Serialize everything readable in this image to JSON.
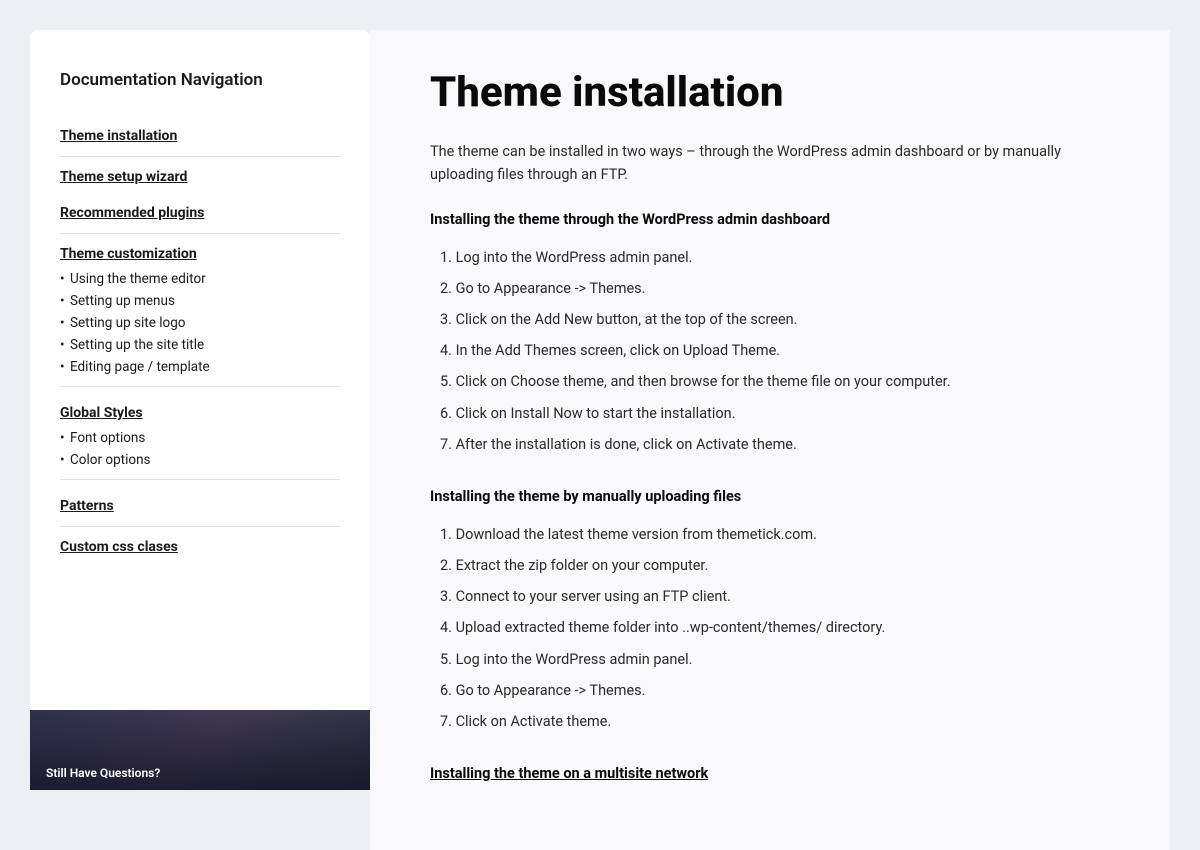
{
  "sidebar": {
    "title": "Documentation Navigation",
    "nav_items": [
      {
        "id": "theme-installation",
        "label": "Theme installation",
        "type": "link"
      },
      {
        "id": "theme-setup-wizard",
        "label": "Theme setup wizard",
        "type": "link"
      },
      {
        "id": "recommended-plugins",
        "label": "Recommended plugins",
        "type": "link"
      },
      {
        "id": "theme-customization",
        "label": "Theme customization",
        "type": "section",
        "children": [
          "Using the theme editor",
          "Setting up menus",
          "Setting up site logo",
          "Setting up the site title",
          "Editing page / template"
        ]
      },
      {
        "id": "global-styles",
        "label": "Global Styles",
        "type": "section",
        "children": [
          "Font options",
          "Color options"
        ]
      },
      {
        "id": "patterns",
        "label": "Patterns",
        "type": "link"
      },
      {
        "id": "custom-css-classes",
        "label": "Custom css clases",
        "type": "link"
      }
    ],
    "thumbnail_text": "Still Have Questions?"
  },
  "main": {
    "page_title": "Theme installation",
    "intro": "The theme can be installed in two ways – through the WordPress admin dashboard or by manually uploading files through an FTP.",
    "sections": [
      {
        "id": "admin-dashboard",
        "heading": "Installing the theme through the WordPress admin dashboard",
        "heading_type": "bold",
        "items": [
          "Log into the WordPress admin panel.",
          "Go to Appearance -> Themes.",
          "Click on the Add New button, at the top of the screen.",
          "In the Add Themes screen, click on Upload Theme.",
          "Click on Choose theme, and then browse for the theme file on your computer.",
          "Click on Install Now to start the installation.",
          "After the installation is done, click on Activate theme."
        ]
      },
      {
        "id": "ftp-upload",
        "heading": "Installing the theme by manually uploading files",
        "heading_type": "bold",
        "items": [
          "Download the latest theme version from themetick.com.",
          "Extract the zip folder on your computer.",
          "Connect to your server using an FTP client.",
          "Upload extracted theme folder into ..wp-content/themes/ directory.",
          "Log into the WordPress admin panel.",
          "Go to Appearance -> Themes.",
          "Click on Activate theme."
        ]
      },
      {
        "id": "multisite",
        "heading": "Installing the theme on a multisite network",
        "heading_type": "underline",
        "items": []
      }
    ]
  }
}
